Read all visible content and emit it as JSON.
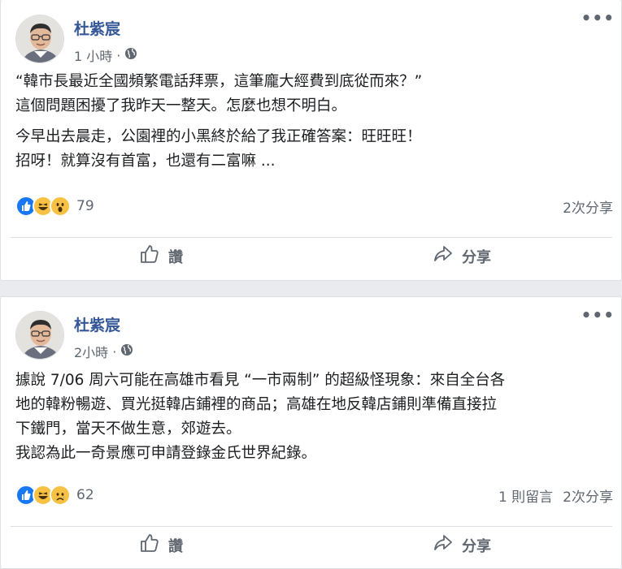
{
  "posts": [
    {
      "author": "杜紫宸",
      "time": "1 小時",
      "text_p1_l1": "“韓市長最近全國頻繁電話拜票，這筆龐大經費到底從而來？”",
      "text_p1_l2": "這個問題困擾了我昨天一整天。怎麼也想不明白。",
      "text_p2_l1": "今早出去晨走，公園裡的小黑終於給了我正確答案：旺旺旺！",
      "text_p2_l2": "招呀！就算沒有首富，也還有二富嘛 ...",
      "reactions": [
        "like",
        "haha",
        "wow"
      ],
      "reaction_count": "79",
      "comments": "",
      "shares": "2次分享",
      "like_label": "讚",
      "share_label": "分享"
    },
    {
      "author": "杜紫宸",
      "time": "2小時",
      "text_l1": "據說 7/06 周六可能在高雄市看見 “一市兩制” 的超級怪現象：來自全台各",
      "text_l2": "地的韓粉暢遊、買光挺韓店鋪裡的商品；高雄在地反韓店鋪則準備直接拉",
      "text_l3": "下鐵門，當天不做生意，郊遊去。",
      "text_l4": "我認為此一奇景應可申請登錄金氏世界紀錄。",
      "reactions": [
        "like",
        "haha",
        "sad"
      ],
      "reaction_count": "62",
      "comments": "1 則留言",
      "shares": "2次分享",
      "like_label": "讚",
      "share_label": "分享"
    }
  ],
  "colors": {
    "author": "#365899",
    "like_blue": "#1877f2",
    "emoji_yellow": "#f7c244",
    "muted": "#606770"
  },
  "icons": {
    "more": "more-horizontal-icon",
    "privacy": "globe-icon",
    "like_action": "thumbs-up-outline-icon",
    "share_action": "share-arrow-icon"
  },
  "meta_separator": "·",
  "more_glyph": "•••"
}
